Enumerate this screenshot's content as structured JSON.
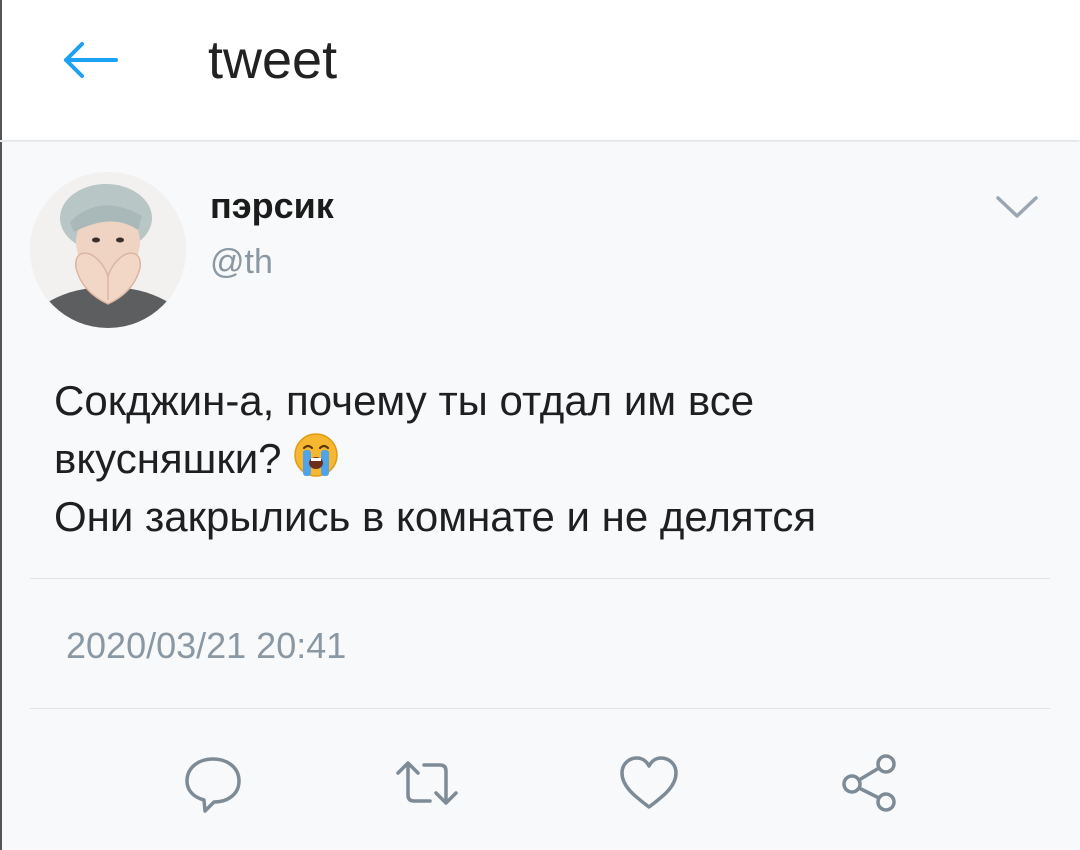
{
  "header": {
    "title": "tweet",
    "back_icon": "arrow-left-icon",
    "accent_color": "#1da1f2"
  },
  "tweet": {
    "display_name": "пэрсик",
    "handle": "@th",
    "text_line1": "Сокджин-а, почему ты отдал им все",
    "text_line2": "вкусняшки?",
    "text_line3": "Они закрылись в комнате и не делятся",
    "emoji": "loudly-crying-face",
    "timestamp": "2020/03/21 20:41"
  },
  "actions": [
    {
      "name": "reply",
      "icon": "comment-bubble-icon"
    },
    {
      "name": "retweet",
      "icon": "retweet-icon"
    },
    {
      "name": "like",
      "icon": "heart-icon"
    },
    {
      "name": "share",
      "icon": "share-nodes-icon"
    }
  ]
}
